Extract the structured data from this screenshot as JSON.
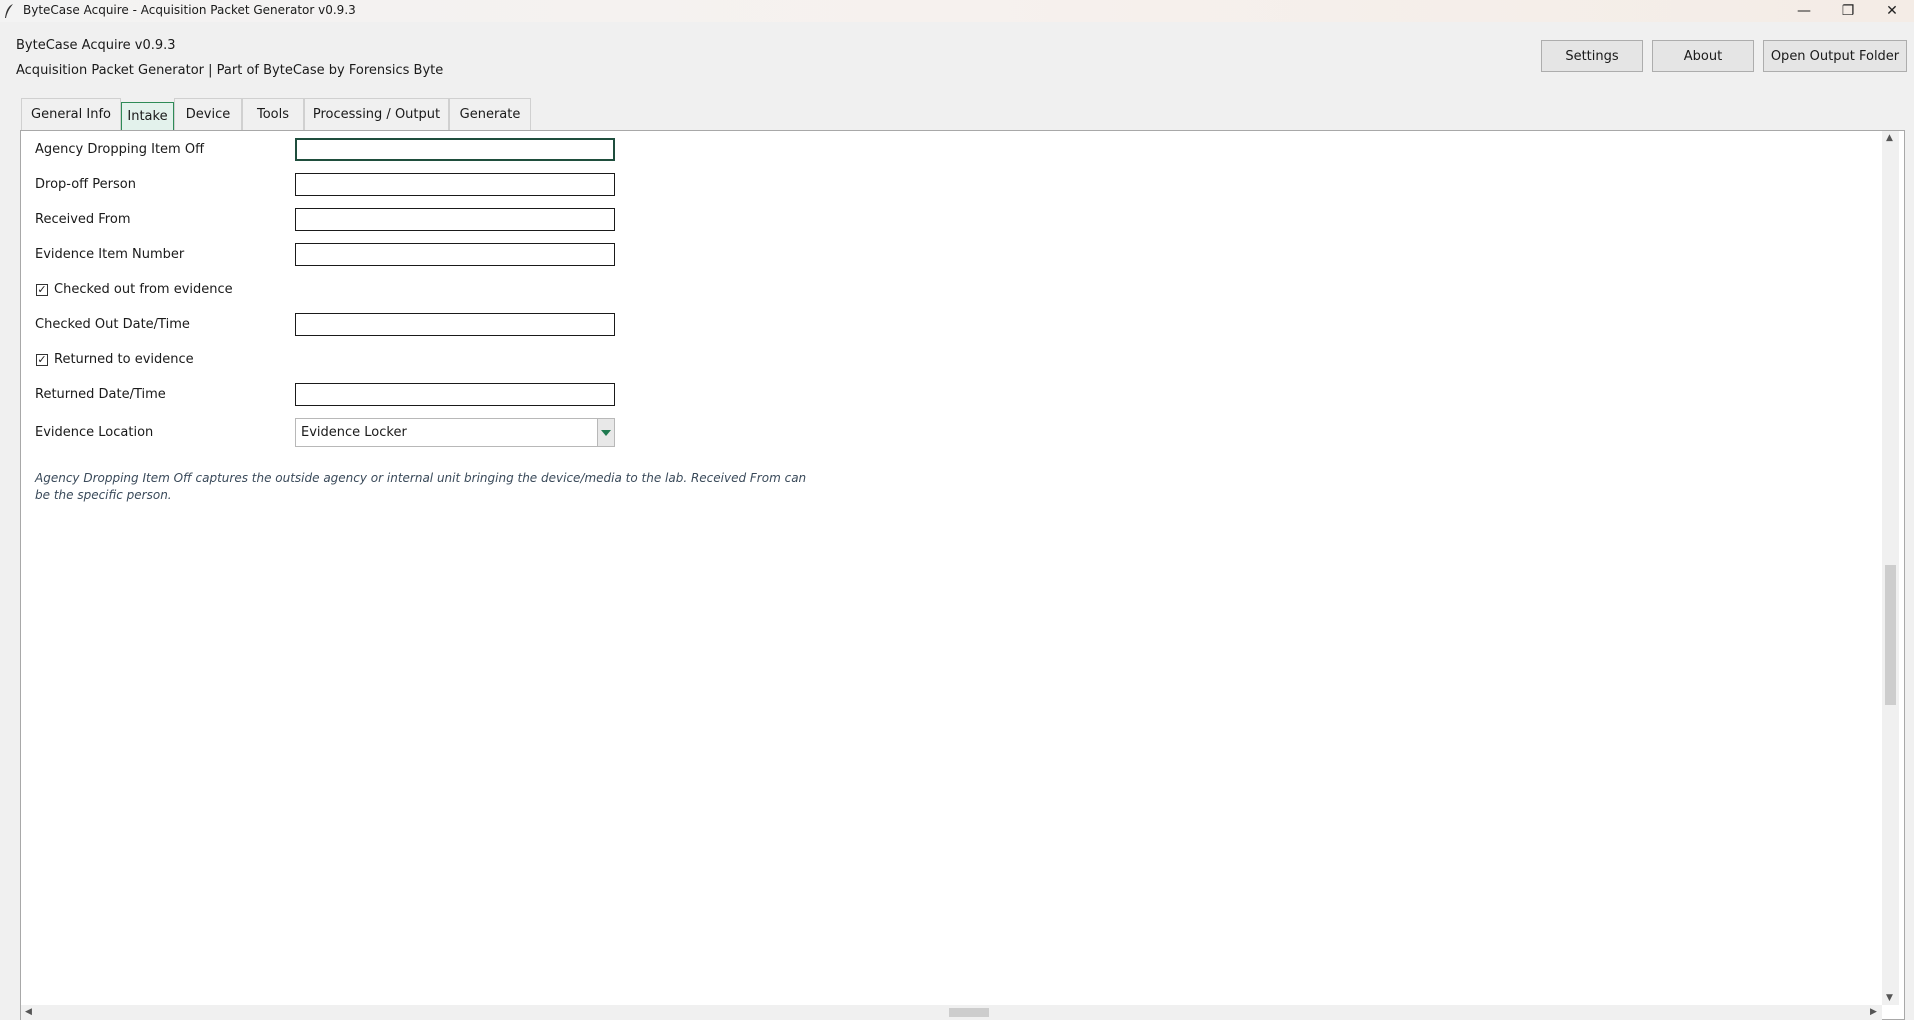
{
  "window": {
    "title": "ByteCase Acquire - Acquisition Packet Generator v0.9.3",
    "minimize_glyph": "—",
    "maximize_glyph": "❐",
    "close_glyph": "✕"
  },
  "header": {
    "app_title": "ByteCase Acquire v0.9.3",
    "subtitle": "Acquisition Packet Generator | Part of ByteCase by Forensics Byte",
    "settings_label": "Settings",
    "about_label": "About",
    "open_output_label": "Open Output Folder"
  },
  "tabs": [
    {
      "label": "General Info",
      "active": false
    },
    {
      "label": "Intake",
      "active": true
    },
    {
      "label": "Device",
      "active": false
    },
    {
      "label": "Tools",
      "active": false
    },
    {
      "label": "Processing / Output",
      "active": false
    },
    {
      "label": "Generate",
      "active": false
    }
  ],
  "form": {
    "agency_label": "Agency Dropping Item Off",
    "agency_value": "",
    "dropoff_label": "Drop-off Person",
    "dropoff_value": "",
    "received_from_label": "Received From",
    "received_from_value": "",
    "evidence_item_label": "Evidence Item Number",
    "evidence_item_value": "",
    "checked_out_label": "Checked out from evidence",
    "checked_out_checked": true,
    "checked_out_datetime_label": "Checked Out Date/Time",
    "checked_out_datetime_value": "",
    "returned_label": "Returned to evidence",
    "returned_checked": true,
    "returned_datetime_label": "Returned Date/Time",
    "returned_datetime_value": "",
    "evidence_location_label": "Evidence Location",
    "evidence_location_value": "Evidence Locker",
    "hint": "Agency Dropping Item Off captures the outside agency or internal unit bringing the device/media to the lab. Received From can be the specific person."
  },
  "check_glyph": "✓",
  "colors": {
    "accent": "#2e8b57",
    "active_tab_bg": "#e3f2ec",
    "hint_text": "#3a4a5a"
  }
}
